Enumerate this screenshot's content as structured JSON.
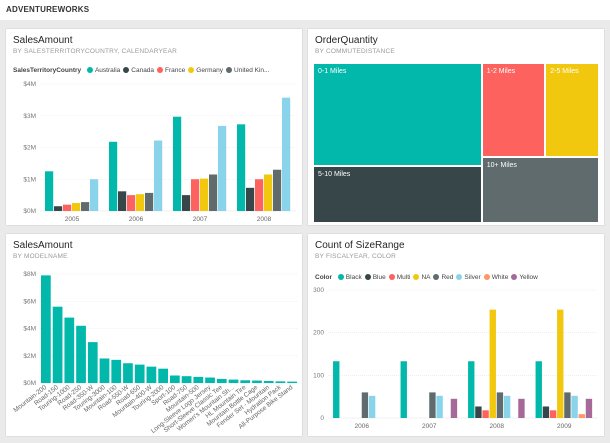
{
  "app": {
    "title": "ADVENTUREWORKS"
  },
  "tiles": [
    {
      "title": "SalesAmount",
      "subtitle": "BY SALESTERRITORYCOUNTRY, CALENDARYEAR",
      "legend_title": "SalesTerritoryCountry",
      "legend": [
        {
          "name": "Australia",
          "color": "#01b8aa"
        },
        {
          "name": "Canada",
          "color": "#374649"
        },
        {
          "name": "France",
          "color": "#fd625e"
        },
        {
          "name": "Germany",
          "color": "#f2c80f"
        },
        {
          "name": "United Kin...",
          "color": "#5f6b6d"
        }
      ]
    },
    {
      "title": "OrderQuantity",
      "subtitle": "BY COMMUTEDISTANCE"
    },
    {
      "title": "SalesAmount",
      "subtitle": "BY MODELNAME"
    },
    {
      "title": "Count of SizeRange",
      "subtitle": "BY FISCALYEAR, COLOR",
      "legend_title": "Color",
      "legend": [
        {
          "name": "Black",
          "color": "#01b8aa"
        },
        {
          "name": "Blue",
          "color": "#374649"
        },
        {
          "name": "Multi",
          "color": "#fd625e"
        },
        {
          "name": "NA",
          "color": "#f2c80f"
        },
        {
          "name": "Red",
          "color": "#5f6b6d"
        },
        {
          "name": "Silver",
          "color": "#8ad4eb"
        },
        {
          "name": "White",
          "color": "#fe9666"
        },
        {
          "name": "Yellow",
          "color": "#a66999"
        }
      ]
    }
  ],
  "chart_data": [
    {
      "type": "bar",
      "categories": [
        "2005",
        "2006",
        "2007",
        "2008"
      ],
      "ylim": [
        0,
        4
      ],
      "yticks": [
        "$0M",
        "$1M",
        "$2M",
        "$3M",
        "$4M"
      ],
      "series": [
        {
          "name": "Australia",
          "color": "#01b8aa",
          "values": [
            1.25,
            2.18,
            2.97,
            2.73
          ]
        },
        {
          "name": "Canada",
          "color": "#374649",
          "values": [
            0.15,
            0.62,
            0.5,
            0.73
          ]
        },
        {
          "name": "France",
          "color": "#fd625e",
          "values": [
            0.2,
            0.5,
            1.0,
            1.0
          ]
        },
        {
          "name": "Germany",
          "color": "#f2c80f",
          "values": [
            0.25,
            0.53,
            1.02,
            1.15
          ]
        },
        {
          "name": "United Kin...",
          "color": "#5f6b6d",
          "values": [
            0.28,
            0.57,
            1.15,
            1.3
          ]
        },
        {
          "name": "",
          "color": "#8ad4eb",
          "values": [
            1.0,
            2.22,
            2.68,
            3.57
          ]
        }
      ]
    },
    {
      "type": "treemap",
      "items": [
        {
          "label": "0-1 Miles",
          "value": 38,
          "color": "#01b8aa"
        },
        {
          "label": "1-2 Miles",
          "value": 13,
          "color": "#fd625e"
        },
        {
          "label": "2-5 Miles",
          "value": 11,
          "color": "#f2c80f"
        },
        {
          "label": "5-10 Miles",
          "value": 21,
          "color": "#374649"
        },
        {
          "label": "10+ Miles",
          "value": 17,
          "color": "#5f6b6d"
        }
      ]
    },
    {
      "type": "bar",
      "ylim": [
        0,
        8
      ],
      "yticks": [
        "$0M",
        "$2M",
        "$4M",
        "$6M",
        "$8M"
      ],
      "color": "#01b8aa",
      "categories": [
        "Mountain-200",
        "Road-150",
        "Touring-1000",
        "Road-250",
        "Road-350-W",
        "Touring-3000",
        "Mountain-100",
        "Road-550-W",
        "Road-650",
        "Mountain-400-W",
        "Touring-2000",
        "Sport-100",
        "Road-750",
        "Mountain-500",
        "Long-Sleeve Logo Jersey",
        "Short-Sleeve Classic Tee",
        "Women's Mountain Sh...",
        "HL Mountain Tire",
        "Mountain Bottle Cage",
        "Fender Set - Mountain",
        "Hydration Pack",
        "All-Purpose Bike Stand"
      ],
      "values": [
        7.9,
        5.6,
        4.8,
        4.2,
        3.0,
        1.8,
        1.7,
        1.45,
        1.35,
        1.2,
        1.05,
        0.55,
        0.5,
        0.45,
        0.4,
        0.3,
        0.25,
        0.2,
        0.18,
        0.15,
        0.12,
        0.1
      ],
      "labels": [
        "Mountain-200",
        "Road-150",
        "Touring-1000",
        "Road-250",
        "Road-350-W",
        "Touring-3000",
        "Mountain-100",
        "Road-550-W",
        "Road-650",
        "Mountain-400-W",
        "Touring-2000",
        "Sport-100",
        "Road-750",
        "Mountain-500",
        "Long-Sleeve Logo Jersey",
        "Short-Sleeve Classic Tee",
        "Women's Mountain Sh...",
        "HL Mountain Tire",
        "Mountain Bottle Cage",
        "Fender Set - Mountain",
        "Hydration Pack",
        "All-Purpose Bike Stand"
      ]
    },
    {
      "type": "bar",
      "categories": [
        "2006",
        "2007",
        "2008",
        "2009"
      ],
      "ylim": [
        0,
        300
      ],
      "yticks": [
        "0",
        "100",
        "200",
        "300"
      ],
      "series": [
        {
          "name": "Black",
          "color": "#01b8aa",
          "values": [
            133,
            133,
            133,
            133
          ]
        },
        {
          "name": "Blue",
          "color": "#374649",
          "values": [
            0,
            0,
            27,
            27
          ]
        },
        {
          "name": "Multi",
          "color": "#fd625e",
          "values": [
            0,
            0,
            18,
            18
          ]
        },
        {
          "name": "NA",
          "color": "#f2c80f",
          "values": [
            0,
            0,
            254,
            254
          ]
        },
        {
          "name": "Red",
          "color": "#5f6b6d",
          "values": [
            60,
            60,
            60,
            60
          ]
        },
        {
          "name": "Silver",
          "color": "#8ad4eb",
          "values": [
            52,
            52,
            52,
            52
          ]
        },
        {
          "name": "White",
          "color": "#fe9666",
          "values": [
            0,
            0,
            0,
            9
          ]
        },
        {
          "name": "Yellow",
          "color": "#a66999",
          "values": [
            0,
            45,
            45,
            45
          ]
        }
      ]
    }
  ]
}
